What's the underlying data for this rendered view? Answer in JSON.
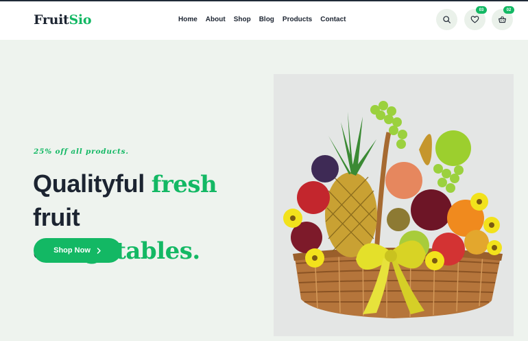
{
  "brand": {
    "part1": "Fruit",
    "part2": "Sio"
  },
  "nav": {
    "items": [
      {
        "label": "Home"
      },
      {
        "label": "About"
      },
      {
        "label": "Shop"
      },
      {
        "label": "Blog"
      },
      {
        "label": "Products"
      },
      {
        "label": "Contact"
      }
    ]
  },
  "header_actions": {
    "search_icon": "search-icon",
    "wishlist_icon": "heart-icon",
    "wishlist_count": "03",
    "cart_icon": "basket-icon",
    "cart_count": "02"
  },
  "hero": {
    "promo": "25% off all products.",
    "headline_part1": "Qualityful ",
    "headline_highlight1": "fresh",
    "headline_part2": " fruit",
    "headline_part3": "& ",
    "headline_highlight2": "vegetables.",
    "cta_label": "Shop Now",
    "cta_icon": "chevron-right-icon",
    "image": "fruit-basket-image"
  },
  "colors": {
    "accent": "#13b864",
    "text_dark": "#1c2431",
    "page_bg": "#eef3ee",
    "header_bg": "#ffffff",
    "image_panel_bg": "#e4e6e5"
  }
}
